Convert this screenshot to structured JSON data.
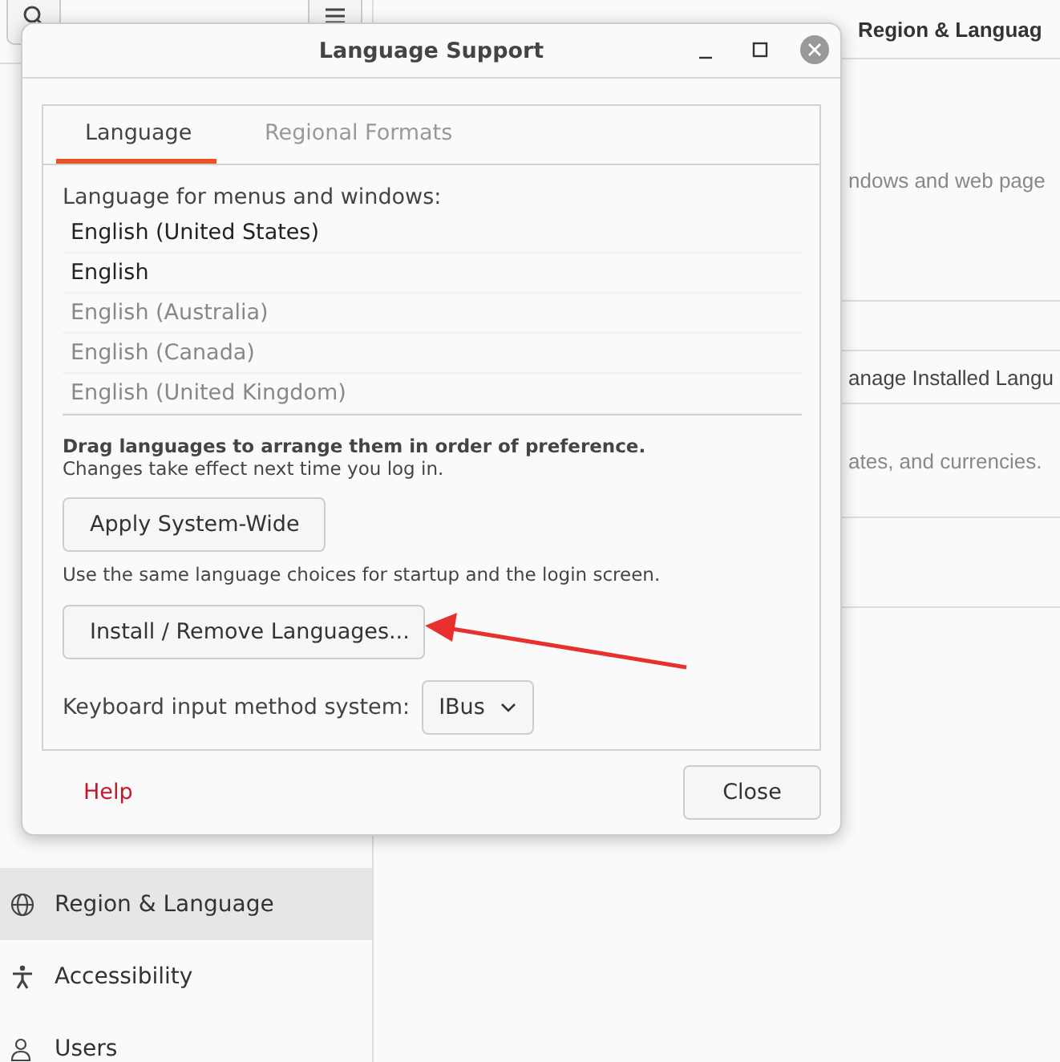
{
  "settings_window": {
    "sidebar": {
      "items": [
        {
          "label": "Region & Language",
          "selected": true
        },
        {
          "label": "Accessibility",
          "selected": false
        },
        {
          "label": "Users",
          "selected": false
        }
      ]
    },
    "panel": {
      "title": "Region & Languag",
      "rows": [
        "ndows and web page",
        "anage Installed Langu",
        "ates, and currencies."
      ]
    }
  },
  "dialog": {
    "title": "Language Support",
    "tabs": [
      {
        "label": "Language",
        "selected": true
      },
      {
        "label": "Regional Formats",
        "selected": false
      }
    ],
    "language_label": "Language for menus and windows:",
    "languages": [
      {
        "name": "English (United States)",
        "installed": true
      },
      {
        "name": "English",
        "installed": true
      },
      {
        "name": "English (Australia)",
        "installed": false
      },
      {
        "name": "English (Canada)",
        "installed": false
      },
      {
        "name": "English (United Kingdom)",
        "installed": false
      }
    ],
    "drag_hint": "Drag languages to arrange them in order of preference.",
    "change_note": "Changes take effect next time you log in.",
    "apply_button": "Apply System-Wide",
    "startup_note": "Use the same language choices for startup and the login screen.",
    "install_button": "Install / Remove Languages...",
    "keyboard_label": "Keyboard input method system:",
    "keyboard_value": "IBus",
    "help_link": "Help",
    "close_button": "Close"
  }
}
